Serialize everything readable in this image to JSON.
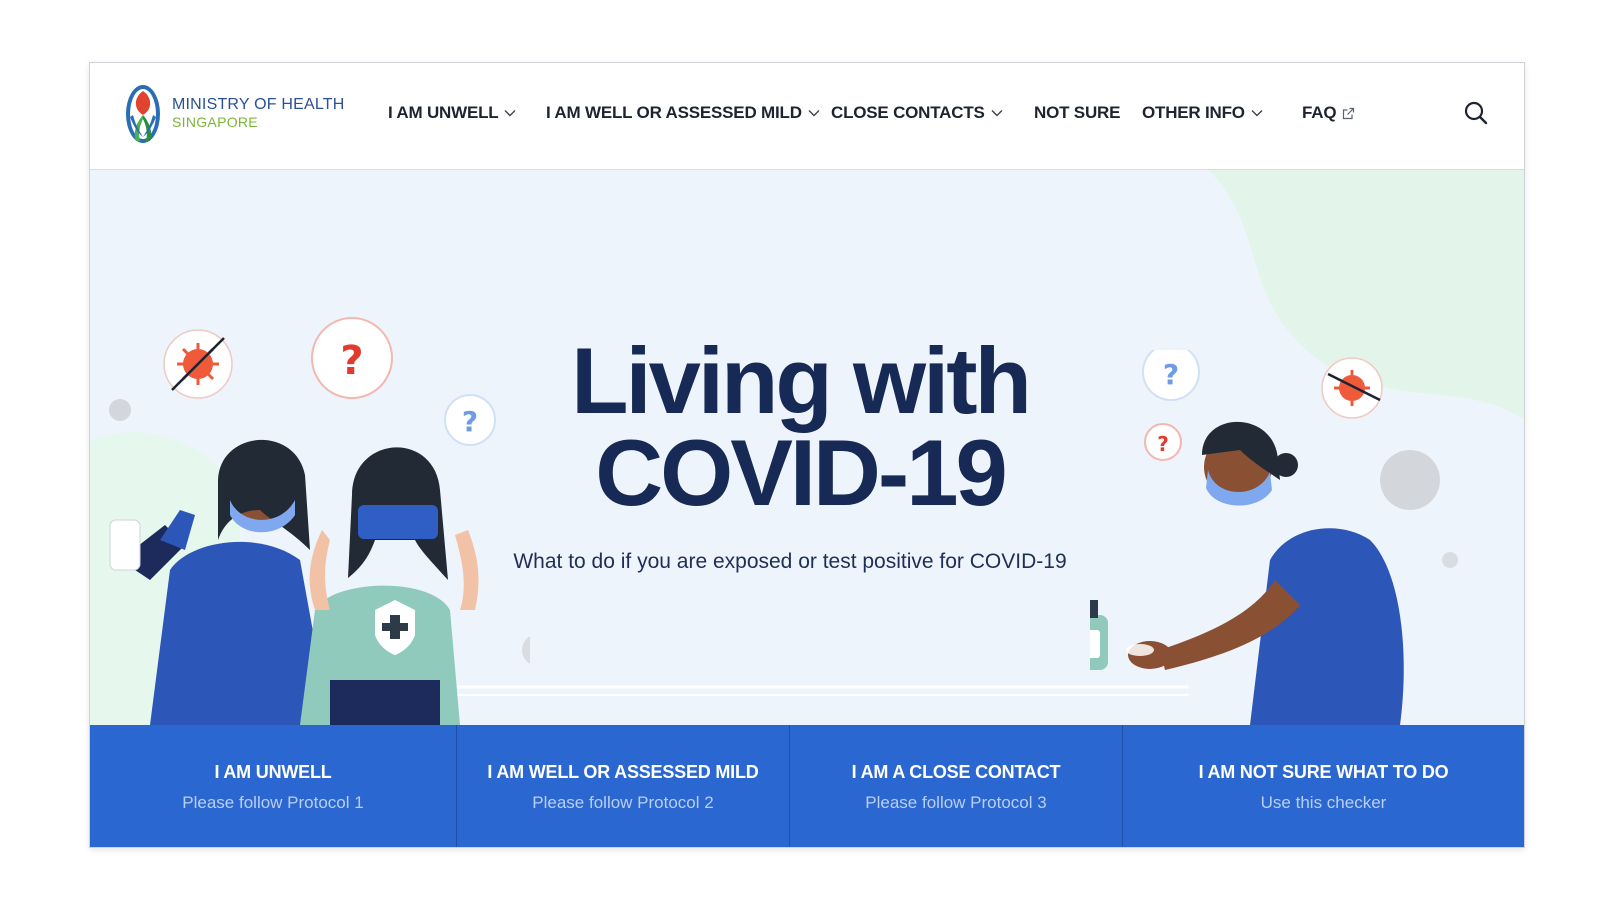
{
  "logo": {
    "line1": "MINISTRY OF HEALTH",
    "line2": "SINGAPORE"
  },
  "nav": {
    "items": [
      {
        "label": "I AM UNWELL",
        "has_dropdown": true
      },
      {
        "label": "I AM WELL OR ASSESSED MILD",
        "has_dropdown": true
      },
      {
        "label": "CLOSE CONTACTS",
        "has_dropdown": true
      },
      {
        "label": "NOT SURE",
        "has_dropdown": false
      },
      {
        "label": "OTHER INFO",
        "has_dropdown": true
      },
      {
        "label": "FAQ",
        "has_dropdown": false,
        "external": true
      }
    ],
    "search_icon": "search-icon"
  },
  "hero": {
    "title_line1": "Living with",
    "title_line2": "COVID-19",
    "subtitle": "What to do if you are exposed or test positive for COVID-19"
  },
  "actions": [
    {
      "title": "I AM UNWELL",
      "subtitle": "Please follow Protocol 1"
    },
    {
      "title": "I AM WELL OR ASSESSED MILD",
      "subtitle": "Please follow Protocol 2"
    },
    {
      "title": "I AM A CLOSE CONTACT",
      "subtitle": "Please follow Protocol 3"
    },
    {
      "title": "I AM NOT SURE WHAT TO DO",
      "subtitle": "Use this checker"
    }
  ],
  "colors": {
    "brand_blue": "#2b67d1",
    "title_navy": "#172a55",
    "hero_bg": "#eef4fb",
    "logo_green": "#7cb43a"
  }
}
